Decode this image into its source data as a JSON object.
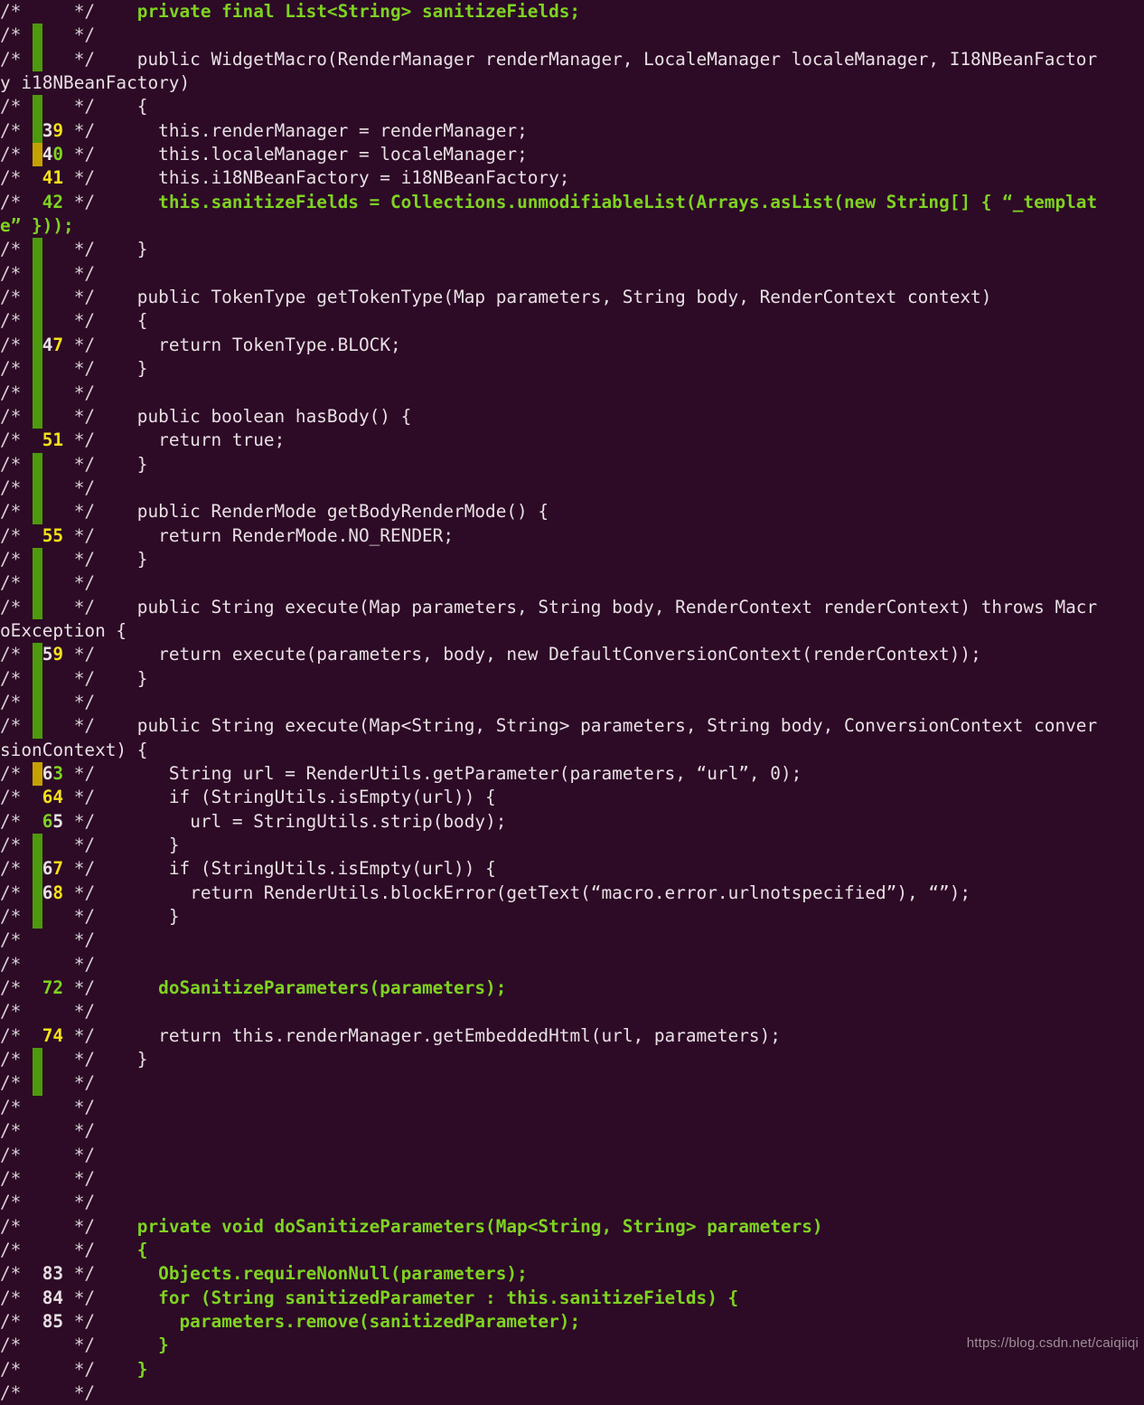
{
  "view": {
    "kind": "code-coverage-report",
    "background_color": "#2d0a26",
    "text_color": "#e8e0e4",
    "covered_color": "#7ed321",
    "line_number_hit_color": "#f4e118",
    "bar_full_color": "#4d9a0c",
    "bar_partial_color": "#c4a000",
    "gutter_open": "/*",
    "gutter_close": "*/",
    "watermark": "https://blog.csdn.net/caiqiiqi"
  },
  "lines": [
    {
      "number": "",
      "bar": "none",
      "marker_cov": true,
      "src_cov": true,
      "text": "    private final List<String> sanitizeFields;"
    },
    {
      "number": "",
      "bar": "green",
      "marker_cov": false,
      "src_cov": false,
      "text": ""
    },
    {
      "number": "",
      "bar": "green",
      "marker_cov": false,
      "src_cov": false,
      "text": "    public WidgetMacro(RenderManager renderManager, LocaleManager localeManager, I18NBeanFactor"
    },
    {
      "number": null,
      "wrap": true,
      "marker_cov": false,
      "src_cov": false,
      "text": "y i18NBeanFactory)"
    },
    {
      "number": "",
      "bar": "green",
      "marker_cov": false,
      "src_cov": false,
      "text": "    {"
    },
    {
      "number": "39",
      "bar": "green",
      "marker_cov": false,
      "src_cov": false,
      "num_style": "mixed-39",
      "text": "      this.renderManager = renderManager;"
    },
    {
      "number": "40",
      "bar": "amber",
      "marker_cov": false,
      "src_cov": false,
      "num_style": "mixed-40",
      "text": "      this.localeManager = localeManager;"
    },
    {
      "number": "41",
      "bar": "none",
      "marker_cov": false,
      "src_cov": false,
      "num_style": "yellow",
      "text": "      this.i18NBeanFactory = i18NBeanFactory;"
    },
    {
      "number": "42",
      "bar": "none",
      "marker_cov": true,
      "src_cov": true,
      "num_style": "green",
      "text": "      this.sanitizeFields = Collections.unmodifiableList(Arrays.asList(new String[] { “_templat"
    },
    {
      "number": null,
      "wrap": true,
      "marker_cov": true,
      "src_cov": true,
      "text": "e” }));"
    },
    {
      "number": "",
      "bar": "green",
      "marker_cov": false,
      "src_cov": false,
      "text": "    }"
    },
    {
      "number": "",
      "bar": "green",
      "marker_cov": false,
      "src_cov": false,
      "text": ""
    },
    {
      "number": "",
      "bar": "green",
      "marker_cov": false,
      "src_cov": false,
      "text": "    public TokenType getTokenType(Map parameters, String body, RenderContext context)"
    },
    {
      "number": "",
      "bar": "green",
      "marker_cov": false,
      "src_cov": false,
      "text": "    {"
    },
    {
      "number": "47",
      "bar": "green",
      "marker_cov": false,
      "src_cov": false,
      "num_style": "mixed-47",
      "text": "      return TokenType.BLOCK;"
    },
    {
      "number": "",
      "bar": "green",
      "marker_cov": false,
      "src_cov": false,
      "text": "    }"
    },
    {
      "number": "",
      "bar": "green",
      "marker_cov": false,
      "src_cov": false,
      "text": ""
    },
    {
      "number": "",
      "bar": "green",
      "marker_cov": false,
      "src_cov": false,
      "text": "    public boolean hasBody() {"
    },
    {
      "number": "51",
      "bar": "none",
      "marker_cov": false,
      "src_cov": false,
      "num_style": "yellow",
      "text": "      return true;"
    },
    {
      "number": "",
      "bar": "green",
      "marker_cov": false,
      "src_cov": false,
      "text": "    }"
    },
    {
      "number": "",
      "bar": "green",
      "marker_cov": false,
      "src_cov": false,
      "text": ""
    },
    {
      "number": "",
      "bar": "green",
      "marker_cov": false,
      "src_cov": false,
      "text": "    public RenderMode getBodyRenderMode() {"
    },
    {
      "number": "55",
      "bar": "none",
      "marker_cov": false,
      "src_cov": false,
      "num_style": "yellow",
      "text": "      return RenderMode.NO_RENDER;"
    },
    {
      "number": "",
      "bar": "green",
      "marker_cov": false,
      "src_cov": false,
      "text": "    }"
    },
    {
      "number": "",
      "bar": "green",
      "marker_cov": false,
      "src_cov": false,
      "text": ""
    },
    {
      "number": "",
      "bar": "green",
      "marker_cov": false,
      "src_cov": false,
      "text": "    public String execute(Map parameters, String body, RenderContext renderContext) throws Macr"
    },
    {
      "number": null,
      "wrap": true,
      "marker_cov": false,
      "src_cov": false,
      "text": "oException {"
    },
    {
      "number": "59",
      "bar": "green",
      "marker_cov": false,
      "src_cov": false,
      "num_style": "mixed-59",
      "text": "      return execute(parameters, body, new DefaultConversionContext(renderContext));"
    },
    {
      "number": "",
      "bar": "green",
      "marker_cov": false,
      "src_cov": false,
      "text": "    }"
    },
    {
      "number": "",
      "bar": "green",
      "marker_cov": false,
      "src_cov": false,
      "text": ""
    },
    {
      "number": "",
      "bar": "green",
      "marker_cov": false,
      "src_cov": false,
      "text": "    public String execute(Map<String, String> parameters, String body, ConversionContext conver"
    },
    {
      "number": null,
      "wrap": true,
      "marker_cov": false,
      "src_cov": false,
      "text": "sionContext) {"
    },
    {
      "number": "63",
      "bar": "amber",
      "marker_cov": false,
      "src_cov": false,
      "num_style": "mixed-63",
      "text": "       String url = RenderUtils.getParameter(parameters, “url”, 0);"
    },
    {
      "number": "64",
      "bar": "none",
      "marker_cov": false,
      "src_cov": false,
      "num_style": "yellow",
      "text": "       if (StringUtils.isEmpty(url)) {"
    },
    {
      "number": "65",
      "bar": "none",
      "marker_cov": false,
      "src_cov": false,
      "num_style": "mixed-65",
      "text": "         url = StringUtils.strip(body);"
    },
    {
      "number": "",
      "bar": "green",
      "marker_cov": false,
      "src_cov": false,
      "text": "       }"
    },
    {
      "number": "67",
      "bar": "green",
      "marker_cov": false,
      "src_cov": false,
      "num_style": "mixed-67",
      "text": "       if (StringUtils.isEmpty(url)) {"
    },
    {
      "number": "68",
      "bar": "green",
      "marker_cov": false,
      "src_cov": false,
      "num_style": "mixed-68",
      "text": "         return RenderUtils.blockError(getText(“macro.error.urlnotspecified”), “”);"
    },
    {
      "number": "",
      "bar": "green",
      "marker_cov": false,
      "src_cov": false,
      "text": "       }"
    },
    {
      "number": "",
      "bar": "none",
      "marker_cov": true,
      "src_cov": true,
      "text": ""
    },
    {
      "number": "",
      "bar": "none",
      "marker_cov": true,
      "src_cov": true,
      "text": ""
    },
    {
      "number": "72",
      "bar": "none",
      "marker_cov": true,
      "src_cov": true,
      "num_style": "green",
      "text": "      doSanitizeParameters(parameters);"
    },
    {
      "number": "",
      "bar": "none",
      "marker_cov": true,
      "src_cov": true,
      "text": ""
    },
    {
      "number": "74",
      "bar": "none",
      "marker_cov": false,
      "src_cov": false,
      "num_style": "yellow",
      "text": "      return this.renderManager.getEmbeddedHtml(url, parameters);"
    },
    {
      "number": "",
      "bar": "green",
      "marker_cov": false,
      "src_cov": false,
      "text": "    }"
    },
    {
      "number": "",
      "bar": "green",
      "marker_cov": false,
      "src_cov": false,
      "text": ""
    },
    {
      "number": "",
      "bar": "none",
      "marker_cov": true,
      "src_cov": true,
      "text": ""
    },
    {
      "number": "",
      "bar": "none",
      "marker_cov": true,
      "src_cov": true,
      "text": ""
    },
    {
      "number": "",
      "bar": "none",
      "marker_cov": true,
      "src_cov": true,
      "text": ""
    },
    {
      "number": "",
      "bar": "none",
      "marker_cov": true,
      "src_cov": true,
      "text": ""
    },
    {
      "number": "",
      "bar": "none",
      "marker_cov": true,
      "src_cov": true,
      "text": ""
    },
    {
      "number": "",
      "bar": "none",
      "marker_cov": true,
      "src_cov": true,
      "text": "    private void doSanitizeParameters(Map<String, String> parameters)"
    },
    {
      "number": "",
      "bar": "none",
      "marker_cov": true,
      "src_cov": true,
      "text": "    {"
    },
    {
      "number": "83",
      "bar": "none",
      "marker_cov": true,
      "src_cov": true,
      "num_style": "white",
      "text": "      Objects.requireNonNull(parameters);"
    },
    {
      "number": "84",
      "bar": "none",
      "marker_cov": true,
      "src_cov": true,
      "num_style": "white",
      "text": "      for (String sanitizedParameter : this.sanitizeFields) {"
    },
    {
      "number": "85",
      "bar": "none",
      "marker_cov": true,
      "src_cov": true,
      "num_style": "white",
      "text": "        parameters.remove(sanitizedParameter);"
    },
    {
      "number": "",
      "bar": "none",
      "marker_cov": true,
      "src_cov": true,
      "text": "      }"
    },
    {
      "number": "",
      "bar": "none",
      "marker_cov": true,
      "src_cov": true,
      "text": "    }"
    },
    {
      "number": "",
      "bar": "none",
      "marker_cov": true,
      "src_cov": true,
      "text": ""
    }
  ],
  "mixed_numbers": {
    "mixed-39": [
      {
        "t": "3",
        "c": "#e8e0e4"
      },
      {
        "t": "9",
        "c": "#f4e118"
      }
    ],
    "mixed-40": [
      {
        "t": "4",
        "c": "#e8e0e4"
      },
      {
        "t": "0",
        "c": "#7ed321"
      }
    ],
    "mixed-47": [
      {
        "t": "4",
        "c": "#e8e0e4"
      },
      {
        "t": "7",
        "c": "#f4e118"
      }
    ],
    "mixed-59": [
      {
        "t": "5",
        "c": "#e8e0e4"
      },
      {
        "t": "9",
        "c": "#f4e118"
      }
    ],
    "mixed-63": [
      {
        "t": "6",
        "c": "#e8e0e4"
      },
      {
        "t": "3",
        "c": "#7ed321"
      }
    ],
    "mixed-65": [
      {
        "t": "6",
        "c": "#7ed321"
      },
      {
        "t": "5",
        "c": "#e8e0e4"
      }
    ],
    "mixed-67": [
      {
        "t": "6",
        "c": "#e8e0e4"
      },
      {
        "t": "7",
        "c": "#f4e118"
      }
    ],
    "mixed-68": [
      {
        "t": "6",
        "c": "#e8e0e4"
      },
      {
        "t": "8",
        "c": "#f4e118"
      }
    ]
  }
}
